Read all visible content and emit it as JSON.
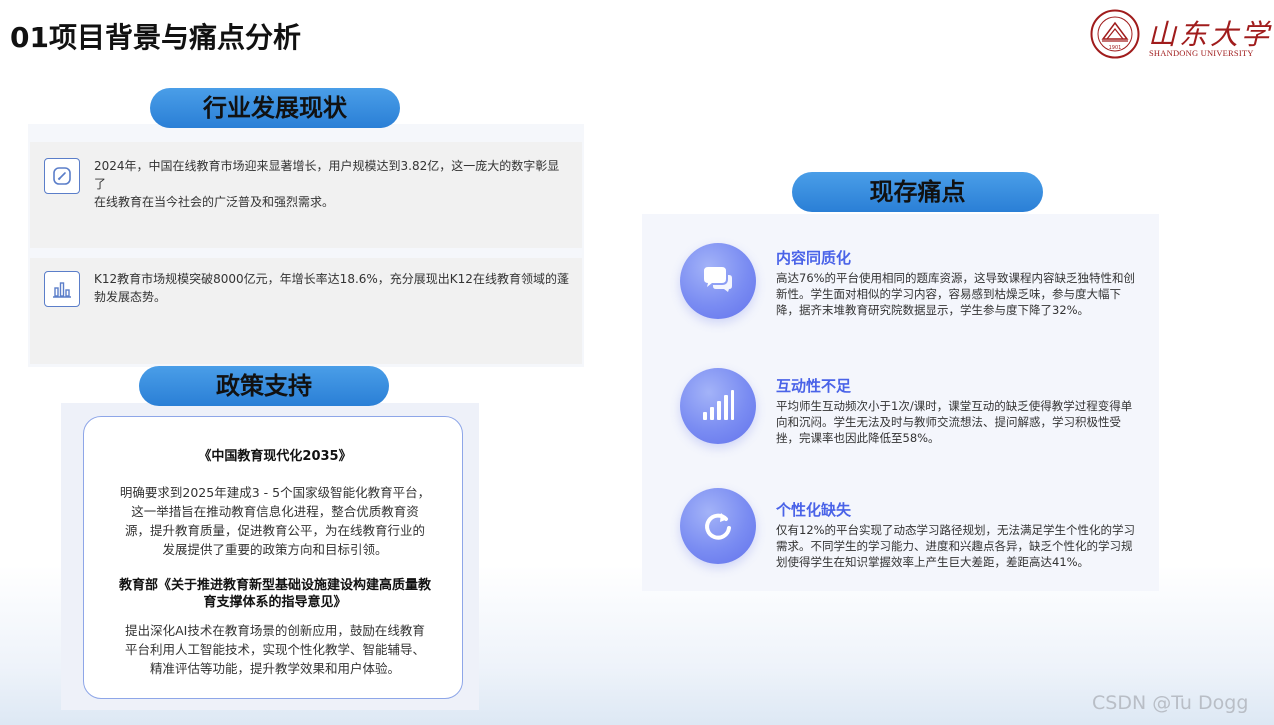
{
  "header": {
    "title": "01项目背景与痛点分析",
    "logo_cn": "山东大学",
    "logo_en": "SHANDONG UNIVERSITY",
    "seal_text": "1901",
    "brand_color": "#a01c1c"
  },
  "industry": {
    "heading": "行业发展现状",
    "cards": [
      {
        "icon": "edit-icon",
        "lines": [
          "2024年，中国在线教育市场迎来显著增长，用户规模达到3.82亿，这一庞大的数字彰显了",
          "在线教育在当今社会的广泛普及和强烈需求。"
        ]
      },
      {
        "icon": "bar-chart-icon",
        "lines": [
          "K12教育市场规模突破8000亿元，年增长率达18.6%，充分展现出K12在线教育领域的蓬",
          "勃发展态势。"
        ]
      }
    ]
  },
  "policy": {
    "heading": "政策支持",
    "doc1_title": "《中国教育现代化2035》",
    "doc1_lines": [
      "明确要求到2025年建成3 - 5个国家级智能化教育平台，",
      "这一举措旨在推动教育信息化进程，整合优质教育资",
      "源，提升教育质量，促进教育公平，为在线教育行业的",
      "发展提供了重要的政策方向和目标引领。"
    ],
    "doc2_title_lines": [
      "教育部《关于推进教育新型基础设施建设构建高质量教",
      "育支撑体系的指导意见》"
    ],
    "doc2_lines": [
      "提出深化AI技术在教育场景的创新应用，鼓励在线教育",
      "平台利用人工智能技术，实现个性化教学、智能辅导、",
      "精准评估等功能，提升教学效果和用户体验。"
    ]
  },
  "pain_points": {
    "heading": "现存痛点",
    "accent": "#4a63e8",
    "items": [
      {
        "icon": "chat-bubbles-icon",
        "title": "内容同质化",
        "lines": [
          "高达76%的平台使用相同的题库资源，这导致课程内容缺乏独特性和创",
          "新性。学生面对相似的学习内容，容易感到枯燥乏味，参与度大幅下",
          "降，据齐末堆教育研究院数据显示，学生参与度下降了32%。"
        ]
      },
      {
        "icon": "signal-bars-icon",
        "title": "互动性不足",
        "lines": [
          "平均师生互动频次小于1次/课时，课堂互动的缺乏使得教学过程变得单",
          "向和沉闷。学生无法及时与教师交流想法、提问解惑，学习积极性受",
          "挫，完课率也因此降低至58%。"
        ]
      },
      {
        "icon": "refresh-icon",
        "title": "个性化缺失",
        "lines": [
          "仅有12%的平台实现了动态学习路径规划，无法满足学生个性化的学习",
          "需求。不同学生的学习能力、进度和兴趣点各异，缺乏个性化的学习规",
          "划使得学生在知识掌握效率上产生巨大差距，差距高达41%。"
        ]
      }
    ]
  },
  "watermark": "CSDN @Tu Dogg"
}
